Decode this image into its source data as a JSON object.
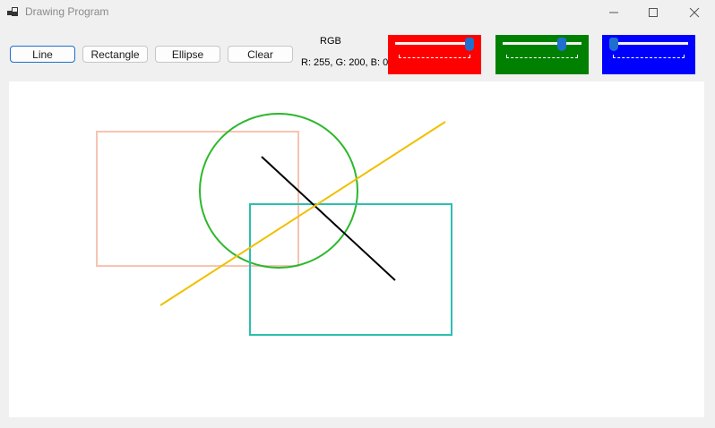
{
  "window": {
    "title": "Drawing Program"
  },
  "toolbar": {
    "line_label": "Line",
    "rectangle_label": "Rectangle",
    "ellipse_label": "Ellipse",
    "clear_label": "Clear"
  },
  "color": {
    "label": "RGB",
    "value_text": "R: 255, G: 200, B: 0",
    "red": 255,
    "green": 200,
    "blue": 0,
    "slider_colors": {
      "red": "#ff0000",
      "green": "#008000",
      "blue": "#0000ff"
    }
  },
  "icons": [
    "app-icon",
    "minimize-icon",
    "maximize-icon",
    "close-icon"
  ],
  "drawing": {
    "shape_colors": {
      "rectangle_1": "#f6c4b1",
      "rectangle_2": "#2bbfae",
      "ellipse": "#2cb82c",
      "line_1": "#000000",
      "line_2": "#f0c000"
    }
  }
}
